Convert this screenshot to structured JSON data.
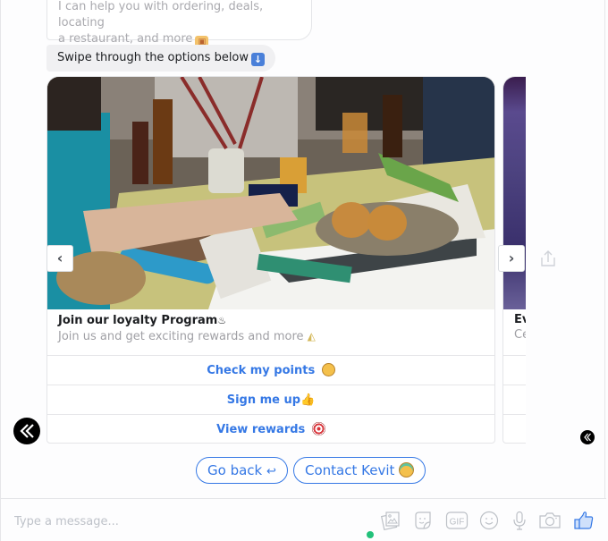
{
  "messages": [
    {
      "text_line1": "I can help you with ordering, deals, locating",
      "text_line2": "a restaurant, and more",
      "emoji": "gift-icon"
    },
    {
      "text": "Swipe through the options below",
      "emoji": "down-arrow-icon"
    }
  ],
  "carousel": {
    "cards": [
      {
        "title": "Join our loyalty Program",
        "title_emoji": "person-in-bath-icon",
        "subtitle": "Join us and get exciting rewards and more",
        "subtitle_emoji": "party-popper-icon",
        "image_alt": "Dinner party table with food, drinks and crackers",
        "buttons": [
          {
            "label": "Check my points",
            "emoji": "face-with-monocle-icon"
          },
          {
            "label": "Sign me up",
            "emoji": "thumbs-up-icon"
          },
          {
            "label": "View rewards",
            "emoji": "direct-hit-icon"
          }
        ]
      },
      {
        "title": "Ev",
        "subtitle": "Ce"
      }
    ],
    "prev_label": "‹",
    "next_label": "›"
  },
  "quick_replies": [
    {
      "label": "Go back",
      "suffix": "↩"
    },
    {
      "label": "Contact Kevit",
      "emoji": "smiling-face-with-halo-icon"
    }
  ],
  "composer": {
    "placeholder": "Type a message...",
    "value": "",
    "tools": [
      "image-icon",
      "sticker-icon",
      "gif-icon",
      "emoji-icon",
      "microphone-icon",
      "camera-icon",
      "like-icon"
    ],
    "gif_label": "GIF"
  },
  "colors": {
    "accent": "#3578e5",
    "online": "#23c17a"
  }
}
